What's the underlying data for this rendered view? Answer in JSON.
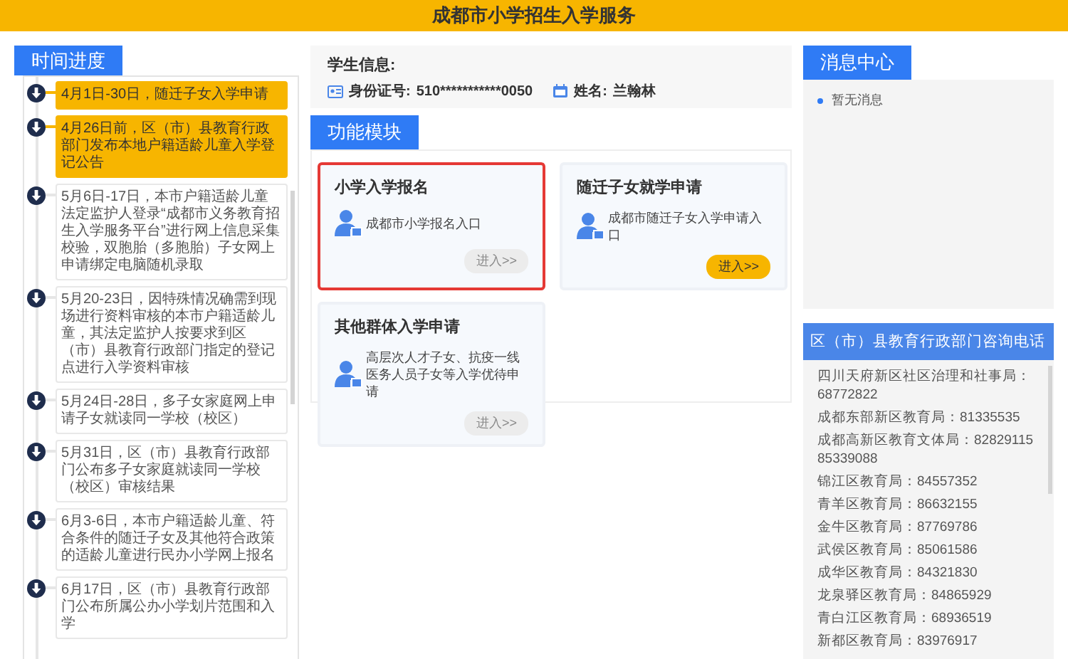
{
  "header": {
    "title": "成都市小学招生入学服务"
  },
  "timeline": {
    "title": "时间进度",
    "items": [
      {
        "text": "4月1日-30日，随迁子女入学申请",
        "current": true
      },
      {
        "text": "4月26日前，区（市）县教育行政部门发布本地户籍适龄儿童入学登记公告",
        "current": true
      },
      {
        "text": "5月6日-17日，本市户籍适龄儿童法定监护人登录“成都市义务教育招生入学服务平台”进行网上信息采集校验，双胞胎（多胞胎）子女网上申请绑定电脑随机录取",
        "current": false
      },
      {
        "text": "5月20-23日，因特殊情况确需到现场进行资料审核的本市户籍适龄儿童，其法定监护人按要求到区（市）县教育行政部门指定的登记点进行入学资料审核",
        "current": false
      },
      {
        "text": "5月24日-28日，多子女家庭网上申请子女就读同一学校（校区）",
        "current": false
      },
      {
        "text": "5月31日，区（市）县教育行政部门公布多子女家庭就读同一学校（校区）审核结果",
        "current": false
      },
      {
        "text": "6月3-6日，本市户籍适龄儿童、符合条件的随迁子女及其他符合政策的适龄儿童进行民办小学网上报名",
        "current": false
      },
      {
        "text": "6月17日，区（市）县教育行政部门公布所属公办小学划片范围和入学",
        "current": false
      }
    ]
  },
  "student": {
    "title": "学生信息:",
    "id_label": "身份证号:",
    "id_value": "510***********0050",
    "name_label": "姓名:",
    "name_value": "兰翰林"
  },
  "modules": {
    "title": "功能模块",
    "cards": [
      {
        "title": "小学入学报名",
        "desc": "成都市小学报名入口",
        "button": "进入>>",
        "enabled": false,
        "selected": true
      },
      {
        "title": "随迁子女就学申请",
        "desc": "成都市随迁子女入学申请入口",
        "button": "进入>>",
        "enabled": true,
        "selected": false
      },
      {
        "title": "其他群体入学申请",
        "desc": "高层次人才子女、抗疫一线医务人员子女等入学优待申请",
        "button": "进入>>",
        "enabled": false,
        "selected": false
      }
    ]
  },
  "messages": {
    "title": "消息中心",
    "items": [
      "暂无消息"
    ]
  },
  "contacts": {
    "title": "区（市）县教育行政部门咨询电话",
    "items": [
      "四川天府新区社区治理和社事局：68772822",
      "成都东部新区教育局：81335535",
      "成都高新区教育文体局：82829115 85339088",
      "锦江区教育局：84557352",
      "青羊区教育局：86632155",
      "金牛区教育局：87769786",
      "武侯区教育局：85061586",
      "成华区教育局：84321830",
      "龙泉驿区教育局：84865929",
      "青白江区教育局：68936519",
      "新都区教育局：83976917"
    ]
  }
}
